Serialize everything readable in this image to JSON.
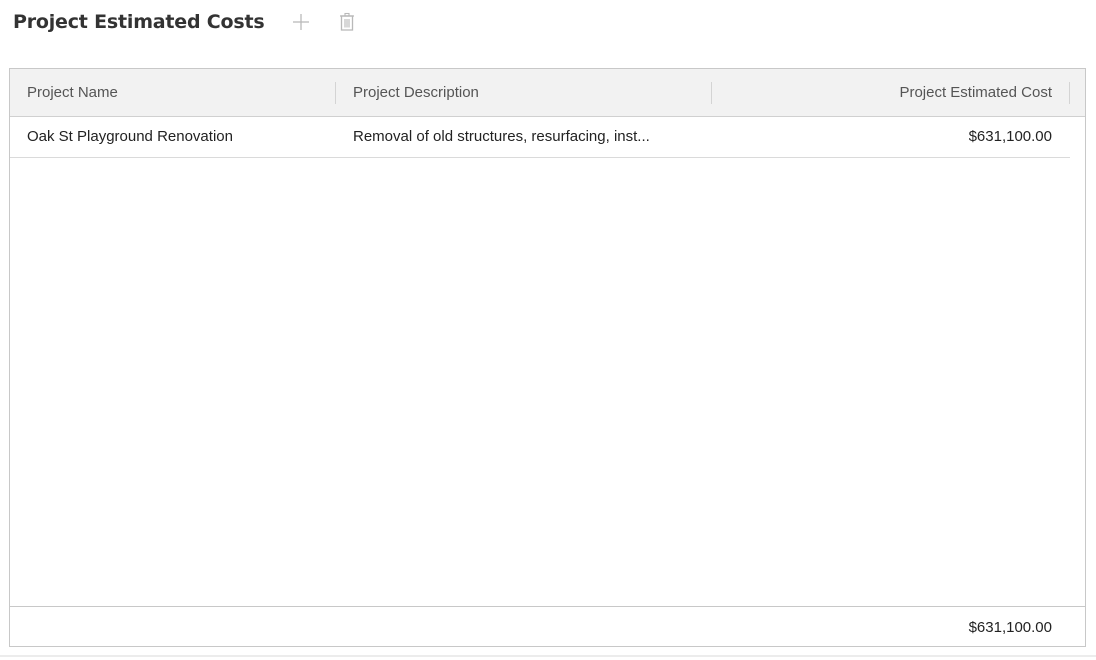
{
  "header": {
    "title": "Project Estimated Costs",
    "add_icon": "plus-icon",
    "delete_icon": "trash-icon"
  },
  "grid": {
    "columns": [
      {
        "label": "Project Name"
      },
      {
        "label": "Project Description"
      },
      {
        "label": "Project Estimated Cost"
      }
    ],
    "rows": [
      {
        "name": "Oak St Playground Renovation",
        "description": "Removal of old structures, resurfacing, inst...",
        "cost": "$631,100.00"
      }
    ],
    "footer_total": "$631,100.00"
  },
  "colors": {
    "header_bg": "#f2f2f2",
    "border": "#c8c8c8",
    "icon": "#b9b9b9"
  }
}
